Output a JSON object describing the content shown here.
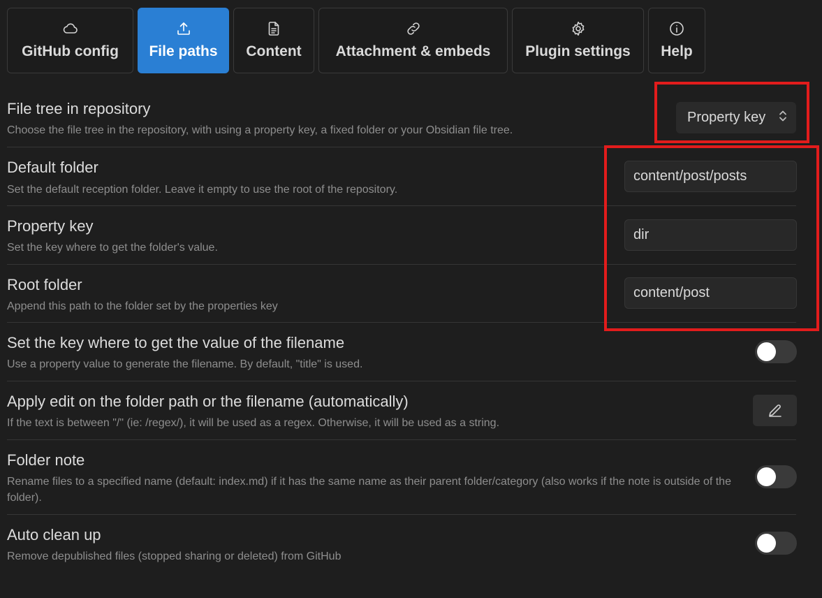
{
  "tabs": [
    {
      "label": "GitHub config",
      "icon": "cloud-icon",
      "active": false
    },
    {
      "label": "File paths",
      "icon": "upload-icon",
      "active": true
    },
    {
      "label": "Content",
      "icon": "document-icon",
      "active": false
    },
    {
      "label": "Attachment & embeds",
      "icon": "link-icon",
      "active": false
    },
    {
      "label": "Plugin settings",
      "icon": "gear-icon",
      "active": false
    },
    {
      "label": "Help",
      "icon": "info-icon",
      "active": false
    }
  ],
  "settings": {
    "file_tree": {
      "name": "File tree in repository",
      "desc": "Choose the file tree in the repository, with using a property key, a fixed folder or your Obsidian file tree.",
      "value": "Property key"
    },
    "default_folder": {
      "name": "Default folder",
      "desc": "Set the default reception folder. Leave it empty to use the root of the repository.",
      "value": "content/post/posts"
    },
    "property_key": {
      "name": "Property key",
      "desc": "Set the key where to get the folder's value.",
      "value": "dir"
    },
    "root_folder": {
      "name": "Root folder",
      "desc": "Append this path to the folder set by the properties key",
      "value": "content/post"
    },
    "filename_key": {
      "name": "Set the key where to get the value of the filename",
      "desc": "Use a property value to generate the filename. By default, \"title\" is used.",
      "enabled": false
    },
    "apply_edit": {
      "name": "Apply edit on the folder path or the filename (automatically)",
      "desc": "If the text is between \"/\" (ie: /regex/), it will be used as a regex. Otherwise, it will be used as a string.",
      "icon": "pencil-icon"
    },
    "folder_note": {
      "name": "Folder note",
      "desc": "Rename files to a specified name (default: index.md) if it has the same name as their parent folder/category (also works if the note is outside of the folder).",
      "enabled": false
    },
    "auto_clean": {
      "name": "Auto clean up",
      "desc": "Remove depublished files (stopped sharing or deleted) from GitHub",
      "enabled": false
    }
  },
  "colors": {
    "background": "#1e1e1e",
    "accent": "#2a7fd4",
    "highlight": "#e21c1c"
  }
}
